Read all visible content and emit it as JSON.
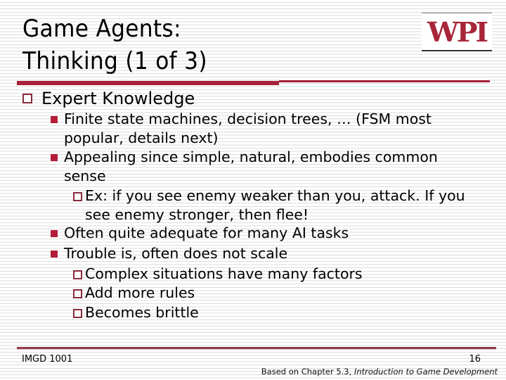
{
  "slide": {
    "title_line1": "Game Agents:",
    "title_line2": "Thinking (1 of 3)",
    "logo_text": "WPI",
    "accent_color": "#a8203a",
    "bullets": {
      "main": "Expert Knowledge",
      "b1": "Finite state machines, decision trees, … (FSM most popular, details next)",
      "b2": "Appealing since simple, natural, embodies common sense",
      "b2_sub1": "Ex: if you see enemy weaker than you, attack.  If you see enemy stronger, then flee!",
      "b3": "Often quite adequate for many AI tasks",
      "b4": "Trouble is, often does not scale",
      "b4_sub1": "Complex situations have many factors",
      "b4_sub2": "Add more rules",
      "b4_sub3": "Becomes brittle"
    },
    "footer": {
      "course": "IMGD 1001",
      "page_number": "16",
      "credit_prefix": "Based on Chapter 5.3, ",
      "credit_book": "Introduction to Game Development"
    }
  }
}
